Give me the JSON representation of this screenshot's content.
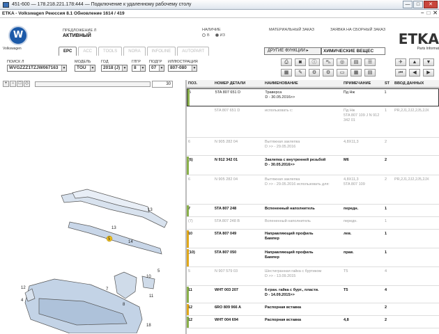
{
  "rdp": {
    "title": "451-600 — 178.218.221.178:444 — Подключение к удаленному рабочему столу",
    "min": "—",
    "max": "□",
    "close": "✕"
  },
  "app": {
    "title": "ETKA - Volkswagen Реюссия 8.1 Обновление 1614 / 419",
    "min": "–",
    "max": "□",
    "close": "✕"
  },
  "header": {
    "brand_text": "Volkswagen",
    "mode_label": "ПРЕДЛОЖЕНИЕ Л",
    "mode_value": "АКТИВНЫЙ",
    "stock_label": "НАЛИЧИЕ",
    "stock_opt1": "В",
    "stock_opt2": "ИЗ",
    "material_order": "МАТЕРИАЛЬНЫЙ ЗАКАЗ",
    "store_order": "ЗАЯВКА НА СБОРНЫЙ ЗАКАЗ",
    "etka": "ETKA",
    "etka_sub": "Parts Informat"
  },
  "tabs": [
    "EPC",
    "ACC",
    "TOOLS",
    "NORA",
    "INFOLINE",
    "AUTOPART"
  ],
  "func_button": "ДРУГИЕ ФУНКЦИИ ▸",
  "group_value": "ХИМИЧЕСКИЕ ВЕЩЕС",
  "selection": {
    "search_label": "ПОИСК Л",
    "search_value": "WVGZZZ1TZJW067163",
    "model_label": "МОДЕЛЬ",
    "model_value": "TOU",
    "year_label": "ГОД",
    "year_value": "2018 (J)",
    "group_label": "ГЛГР",
    "group_value": "8",
    "subgroup_label": "ПОДГР",
    "subgroup_value": "07",
    "illus_label": "ИЛЛЮСТРАЦИЯ",
    "illus_value": "807-080"
  },
  "illus_page": "30",
  "callouts": [
    "5",
    "13",
    "10",
    "11",
    "7",
    "8",
    "12",
    "4",
    "13",
    "18",
    "14",
    "5"
  ],
  "parts_header": {
    "pos": "ПОЗ.",
    "num": "НОМЕР ДЕТАЛИ",
    "name": "НАИМЕНОВАНИЕ",
    "note": "ПРИМЕЧАНИЕ",
    "st": "ST",
    "input": "ВВОД ДАННЫХ"
  },
  "parts": [
    {
      "pos": "5",
      "num": "5TA  807  651  D",
      "name": "Траверса",
      "name2": "D - 30.05.2016>>",
      "note": "Пд Нж",
      "note2": "",
      "st": "1",
      "input": "",
      "style": "sel",
      "mark": "#8ab04a"
    },
    {
      "pos": "",
      "num": "5TA  807  651  D",
      "name": "",
      "name2": "использовать с:",
      "note": "Пд Нж",
      "note2": "5TA 807 109 J   N 912 342 01",
      "st": "1",
      "input": "PR,2J1,2J2,2J5,2JX",
      "style": "dim",
      "mark": ""
    },
    {
      "pos": "6",
      "num": "N  905  282  04",
      "name": "Вытяжная заклепка",
      "name2": "D           >> - 29.05.2016",
      "note": "4,8X11,3",
      "note2": "",
      "st": "2",
      "input": "",
      "style": "dim",
      "mark": ""
    },
    {
      "pos": "(6)",
      "num": "N  912  342  01",
      "name": "Заклепка с внутренней резьбой",
      "name2": "D - 30.05.2016>>",
      "note": "M6",
      "note2": "",
      "st": "2",
      "input": "",
      "style": "bold",
      "mark": "#8ab04a"
    },
    {
      "pos": "6",
      "num": "N  905  282  04",
      "name": "Вытяжная заклепка",
      "name2": "D      >> - 29.05.2016   использовать для:",
      "note": "4,8X11,3",
      "note2": "5TA 807 109",
      "st": "2",
      "input": "PR,2J1,2J2,2J5,2JX",
      "style": "dim",
      "mark": ""
    },
    {
      "pos": "7",
      "num": "5TA  807  248",
      "name": "Вспененный наполнитель",
      "name2": "",
      "note": "передн.",
      "note2": "",
      "st": "1",
      "input": "",
      "style": "bold",
      "mark": "#8ab04a"
    },
    {
      "pos": "(7)",
      "num": "5TA  807  248  B",
      "name": "Вспененный наполнитель",
      "name2": "",
      "note": "передн.",
      "note2": "",
      "st": "1",
      "input": "",
      "style": "dim",
      "mark": ""
    },
    {
      "pos": "10",
      "num": "5TA  807  049",
      "name": "Направляющий профиль",
      "name2": "Бампер",
      "note": "лев.",
      "note2": "",
      "st": "1",
      "input": "",
      "style": "bold",
      "mark": "#e0a81a"
    },
    {
      "pos": "(10)",
      "num": "5TA  807  050",
      "name": "Направляющий профиль",
      "name2": "Бампер",
      "note": "прав.",
      "note2": "",
      "st": "1",
      "input": "",
      "style": "bold",
      "mark": "#e0a81a"
    },
    {
      "pos": "5",
      "num": "N  907  579  03",
      "name": "Шестигранная гайка с буртиком",
      "name2": "D           >> - 13.09.2015",
      "note": "T5",
      "note2": "",
      "st": "4",
      "input": "",
      "style": "dim",
      "mark": ""
    },
    {
      "pos": "11",
      "num": "WHT  003  207",
      "name": "6-гран. гайка с бурт., пласти.",
      "name2": "D - 14.09.2015>>",
      "note": "T5",
      "note2": "",
      "st": "4",
      "input": "",
      "style": "bold",
      "mark": "#8ab04a"
    },
    {
      "pos": "12",
      "num": "6RO  809  966  A",
      "name": "Распорная вставка",
      "name2": "",
      "note": "",
      "note2": "",
      "st": "2",
      "input": "",
      "style": "bold",
      "mark": "#e0a81a"
    },
    {
      "pos": "12",
      "num": "WHT  004  694",
      "name": "Распорная вставка",
      "name2": "",
      "note": "4,8",
      "note2": "",
      "st": "2",
      "input": "",
      "style": "bold",
      "mark": "#8ab04a"
    }
  ],
  "colors": {
    "accent": "#1c5aa8",
    "mark_green": "#8ab04a",
    "mark_amber": "#e0a81a"
  }
}
